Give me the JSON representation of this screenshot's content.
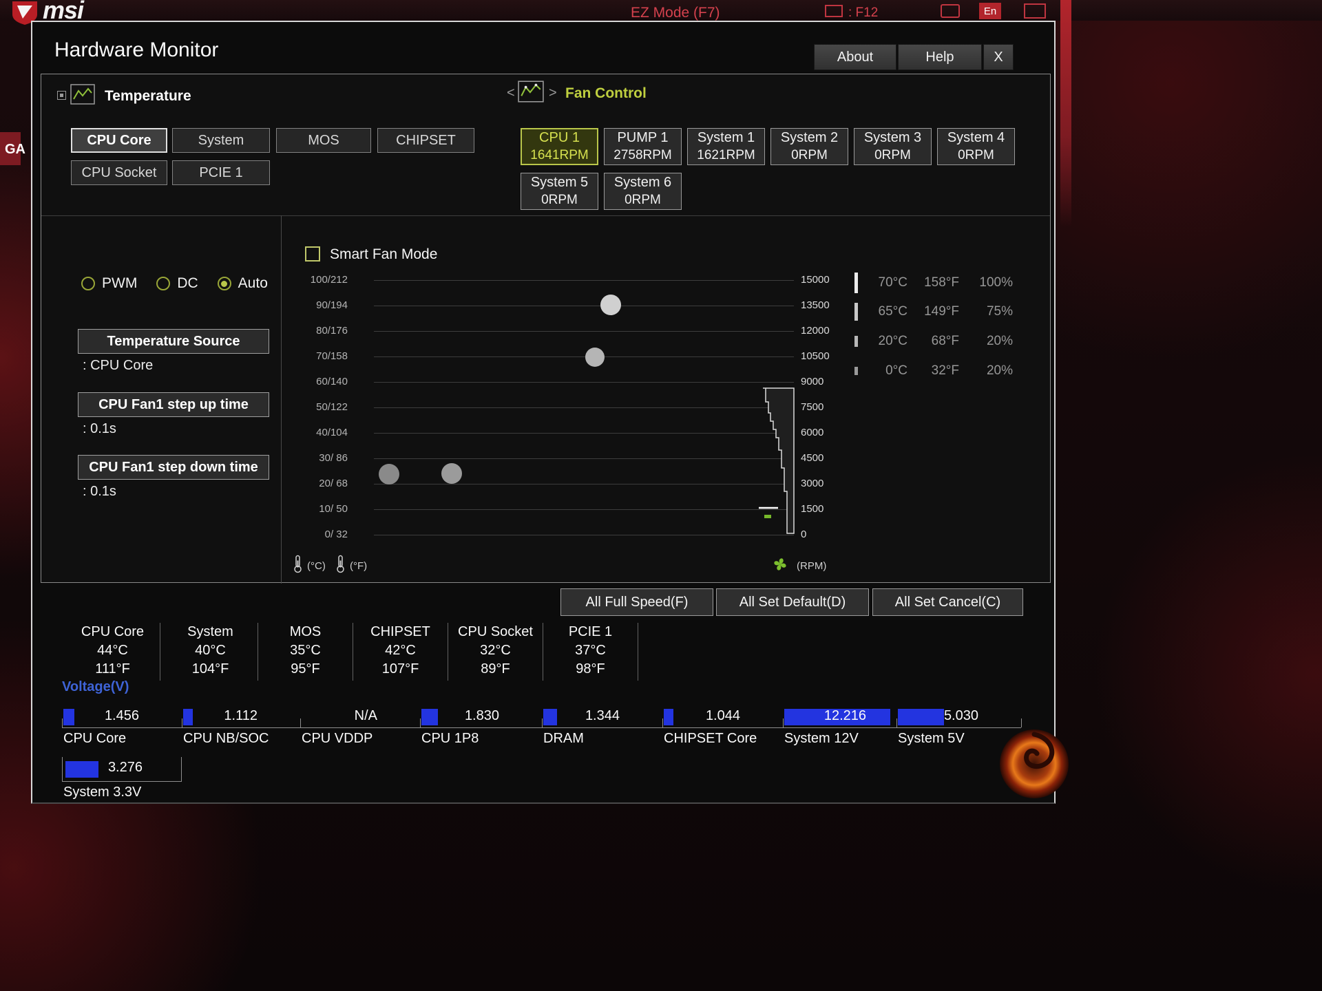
{
  "background": {
    "brand": "msi",
    "ez_mode": "EZ Mode (F7)",
    "f12_hint": ": F12",
    "lang": "En",
    "ga": "GA"
  },
  "window": {
    "title": "Hardware Monitor",
    "about_label": "About",
    "help_label": "Help",
    "close_label": "X"
  },
  "temperature_panel": {
    "title": "Temperature",
    "tabs": [
      {
        "label": "CPU Core"
      },
      {
        "label": "System"
      },
      {
        "label": "MOS"
      },
      {
        "label": "CHIPSET"
      },
      {
        "label": "CPU Socket"
      },
      {
        "label": "PCIE 1"
      }
    ]
  },
  "fan_panel": {
    "title": "Fan Control",
    "prev": "<",
    "next": ">",
    "tabs": [
      {
        "label": "CPU 1",
        "rpm": "1641RPM",
        "active": true
      },
      {
        "label": "PUMP 1",
        "rpm": "2758RPM",
        "active": false
      },
      {
        "label": "System 1",
        "rpm": "1621RPM",
        "active": false
      },
      {
        "label": "System 2",
        "rpm": "0RPM",
        "active": false
      },
      {
        "label": "System 3",
        "rpm": "0RPM",
        "active": false
      },
      {
        "label": "System 4",
        "rpm": "0RPM",
        "active": false
      },
      {
        "label": "System 5",
        "rpm": "0RPM",
        "active": false
      },
      {
        "label": "System 6",
        "rpm": "0RPM",
        "active": false
      }
    ]
  },
  "settings": {
    "modes": [
      {
        "label": "PWM"
      },
      {
        "label": "DC"
      },
      {
        "label": "Auto"
      }
    ],
    "selected_mode": "Auto",
    "temp_source_label": "Temperature Source",
    "temp_source_value": ": CPU Core",
    "step_up_label": "CPU Fan1 step up time",
    "step_up_value": ": 0.1s",
    "step_down_label": "CPU Fan1 step down time",
    "step_down_value": ": 0.1s"
  },
  "chart": {
    "smart_fan_label": "Smart Fan Mode",
    "y_left": [
      "100/212",
      "90/194",
      "80/176",
      "70/158",
      "60/140",
      "50/122",
      "40/104",
      "30/ 86",
      "20/ 68",
      "10/ 50",
      "0/ 32"
    ],
    "y_right": [
      "15000",
      "13500",
      "12000",
      "10500",
      "9000",
      "7500",
      "6000",
      "4500",
      "3000",
      "1500",
      "0"
    ],
    "c_label": "(°C)",
    "f_label": "(°F)",
    "rpm_label": "(RPM)"
  },
  "fan_curve": {
    "points": [
      {
        "temp_c": 0,
        "duty_pct": 20
      },
      {
        "temp_c": 20,
        "duty_pct": 20
      },
      {
        "temp_c": 65,
        "duty_pct": 75
      },
      {
        "temp_c": 70,
        "duty_pct": 100
      }
    ]
  },
  "curve_table": {
    "rows": [
      {
        "c": "70°C",
        "f": "158°F",
        "pct": "100%"
      },
      {
        "c": "65°C",
        "f": "149°F",
        "pct": "75%"
      },
      {
        "c": "20°C",
        "f": "68°F",
        "pct": "20%"
      },
      {
        "c": "0°C",
        "f": "32°F",
        "pct": "20%"
      }
    ]
  },
  "actions": [
    {
      "label": "All Full Speed(F)"
    },
    {
      "label": "All Set Default(D)"
    },
    {
      "label": "All Set Cancel(C)"
    }
  ],
  "temps": [
    {
      "name": "CPU Core",
      "c": "44°C",
      "f": "111°F"
    },
    {
      "name": "System",
      "c": "40°C",
      "f": "104°F"
    },
    {
      "name": "MOS",
      "c": "35°C",
      "f": "95°F"
    },
    {
      "name": "CHIPSET",
      "c": "42°C",
      "f": "107°F"
    },
    {
      "name": "CPU Socket",
      "c": "32°C",
      "f": "89°F"
    },
    {
      "name": "PCIE 1",
      "c": "37°C",
      "f": "98°F"
    }
  ],
  "voltage": {
    "title": "Voltage(V)",
    "items": [
      {
        "name": "CPU Core",
        "value": "1.456"
      },
      {
        "name": "CPU NB/SOC",
        "value": "1.112"
      },
      {
        "name": "CPU VDDP",
        "value": "N/A"
      },
      {
        "name": "CPU 1P8",
        "value": "1.830"
      },
      {
        "name": "DRAM",
        "value": "1.344"
      },
      {
        "name": "CHIPSET Core",
        "value": "1.044"
      },
      {
        "name": "System 12V",
        "value": "12.216"
      },
      {
        "name": "System 5V",
        "value": "5.030"
      },
      {
        "name": "System 3.3V",
        "value": "3.276"
      }
    ]
  }
}
